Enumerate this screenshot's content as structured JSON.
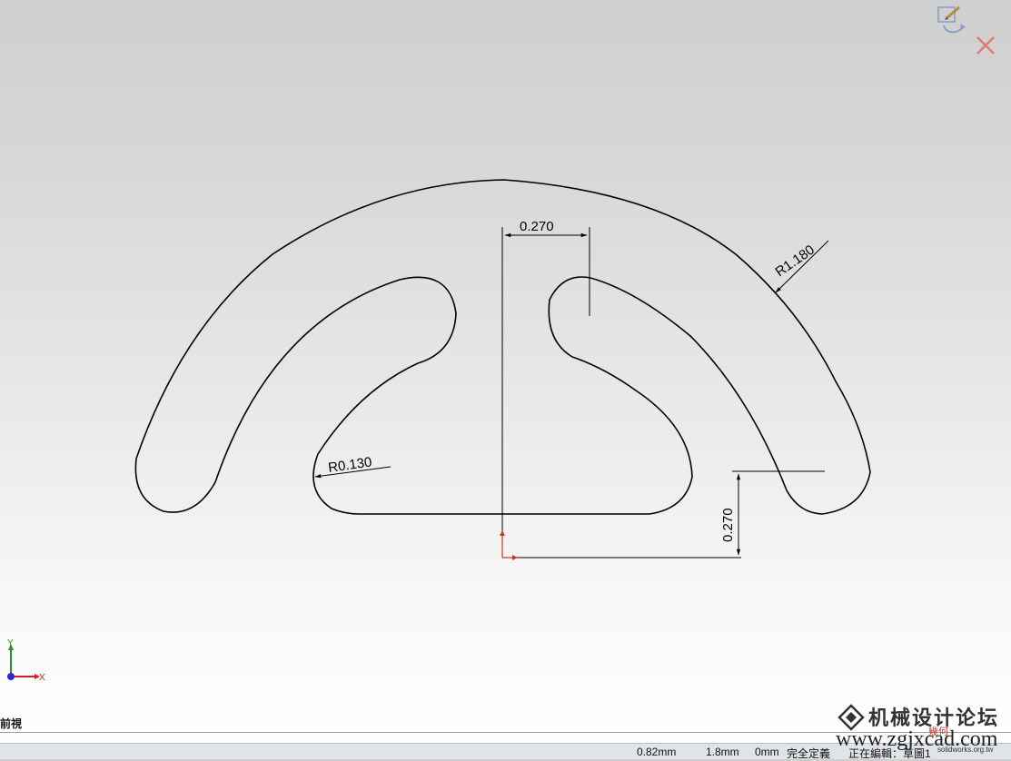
{
  "sketch": {
    "dimensions": {
      "width_270": "0.270",
      "radius_outer": "R1.180",
      "radius_fillet": "R0.130",
      "height_270": "0.270"
    },
    "triad": {
      "x_label": "X",
      "y_label": "Y"
    },
    "colors": {
      "geometry": "#000000",
      "origin": "#c0392b",
      "triad_x": "#cc2222",
      "triad_y": "#2a8f2a",
      "triad_z": "#2a2ad0"
    }
  },
  "confirm_corner": {
    "accept_icon": "edit-sketch-icon",
    "cancel_icon": "close-icon"
  },
  "view_tab": {
    "label": "前視"
  },
  "status_bar": {
    "x_coord": "0.82mm",
    "y_coord": "1.8mm",
    "z_coord": "0mm",
    "definition_state": "完全定義",
    "editing": "正在編輯：草圖1"
  },
  "watermark": {
    "title": "机械设计论坛",
    "url": "www.zgjxcad.com",
    "badge": "幾何",
    "sub": "solidworks.org.tw"
  }
}
